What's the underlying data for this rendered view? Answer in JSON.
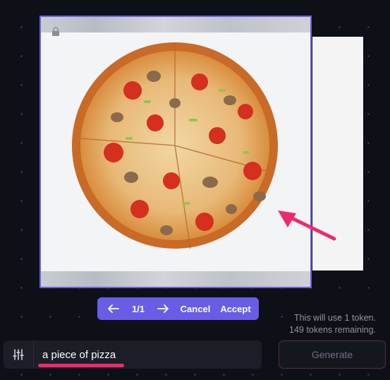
{
  "canvas": {
    "image_subject": "pizza",
    "accent_color": "#6a5ce6",
    "annotation_color": "#ee2a6a"
  },
  "navigator": {
    "prev_icon": "arrow-left-icon",
    "counter": "1/1",
    "next_icon": "arrow-right-icon",
    "cancel_label": "Cancel",
    "accept_label": "Accept"
  },
  "tokens": {
    "usage_line": "This will use 1 token.",
    "remaining_line": "149 tokens remaining."
  },
  "prompt": {
    "settings_icon": "sliders-icon",
    "value": "a piece of pizza"
  },
  "generate": {
    "label": "Generate",
    "border_color": "#5a2a49"
  }
}
